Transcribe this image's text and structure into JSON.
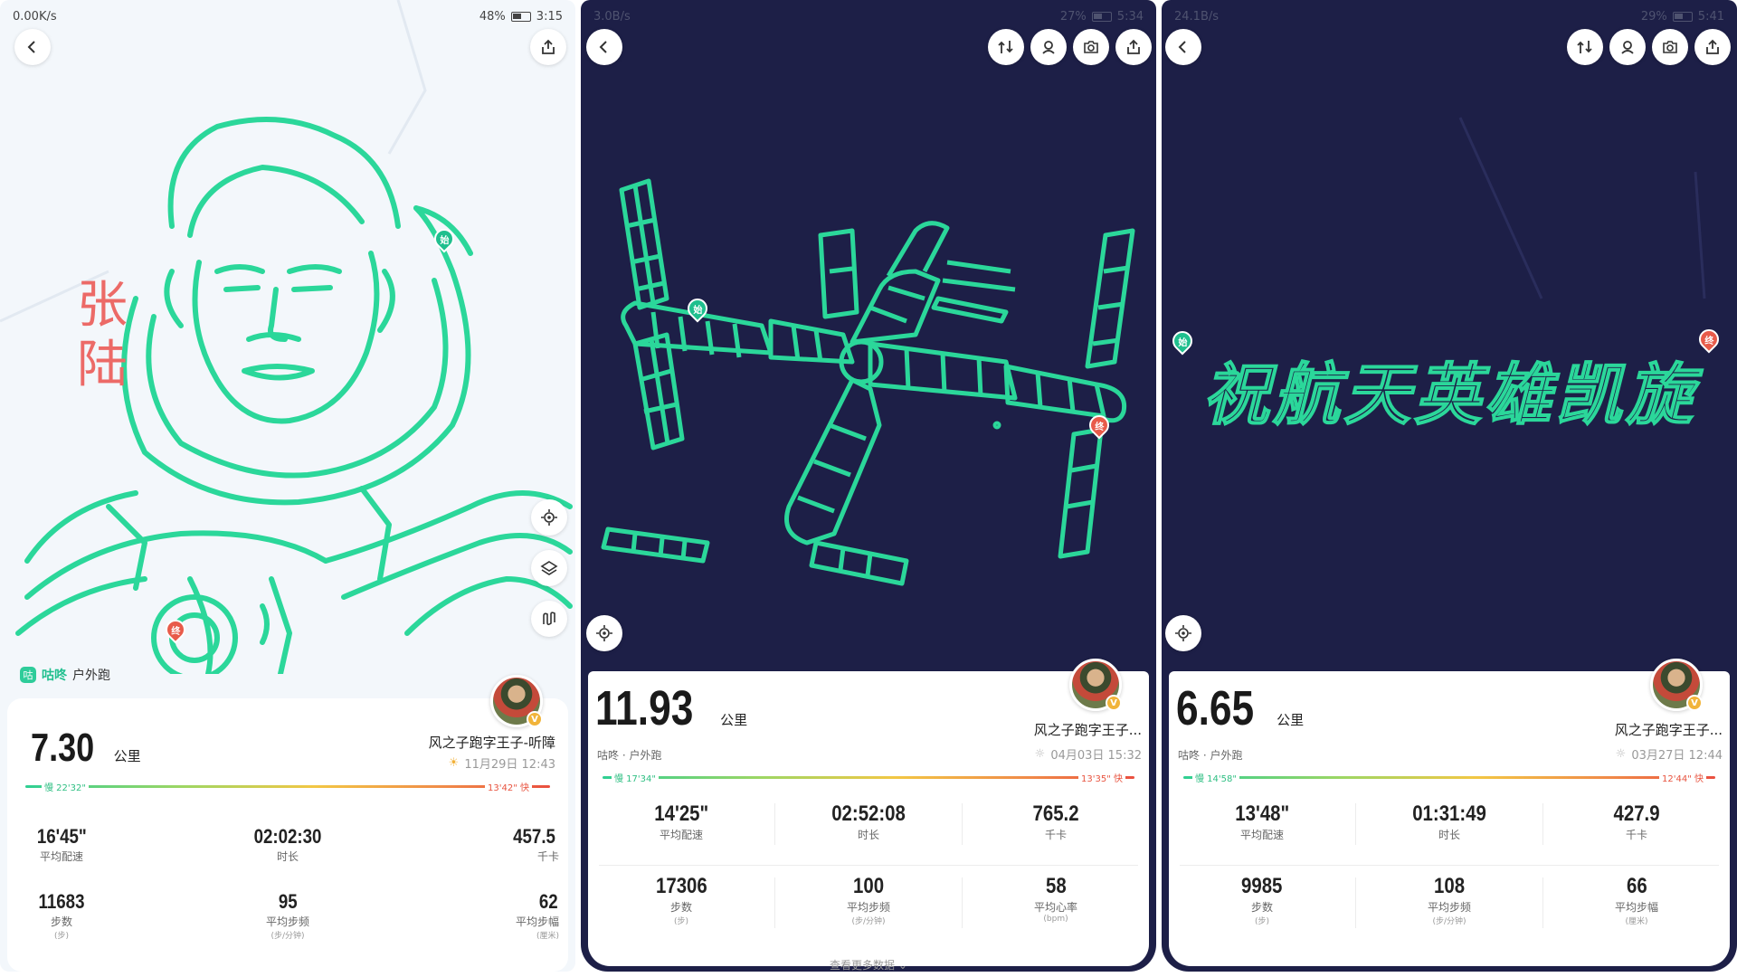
{
  "panels": [
    {
      "status": {
        "net": "0.00K/s",
        "battery": "48%",
        "time": "3:15"
      },
      "name_chars": [
        "张",
        "陆"
      ],
      "brand": {
        "logo": "咕",
        "name": "咕咚",
        "type": "户外跑"
      },
      "summary": {
        "distance": "7.30",
        "unit": "公里",
        "user": "风之子跑字王子-听障",
        "date": "11月29日 12:43"
      },
      "pace": {
        "slow": "慢 22'32\"",
        "fast": "13'42\" 快"
      },
      "stats": [
        {
          "value": "16'45\"",
          "label": "平均配速",
          "sub": ""
        },
        {
          "value": "02:02:30",
          "label": "时长",
          "sub": ""
        },
        {
          "value": "457.5",
          "label": "千卡",
          "sub": ""
        },
        {
          "value": "11683",
          "label": "步数",
          "sub": "(步)"
        },
        {
          "value": "95",
          "label": "平均步频",
          "sub": "(步/分钟)"
        },
        {
          "value": "62",
          "label": "平均步幅",
          "sub": "(厘米)"
        }
      ],
      "pins": {
        "start": "始",
        "end": "终"
      },
      "icons": [
        "back-icon",
        "share-icon",
        "locate-icon",
        "layers-icon",
        "route-icon"
      ]
    },
    {
      "status": {
        "net": "3.0B/s",
        "battery": "27%",
        "time": "5:34"
      },
      "brand": {
        "type": "咕咚 · 户外跑"
      },
      "summary": {
        "distance": "11.93",
        "unit": "公里",
        "user": "风之子跑字王子...",
        "date": "04月03日 15:32"
      },
      "pace": {
        "slow": "慢 17'34\"",
        "fast": "13'35\" 快"
      },
      "stats": [
        {
          "value": "14'25\"",
          "label": "平均配速",
          "sub": ""
        },
        {
          "value": "02:52:08",
          "label": "时长",
          "sub": ""
        },
        {
          "value": "765.2",
          "label": "千卡",
          "sub": ""
        },
        {
          "value": "17306",
          "label": "步数",
          "sub": "(步)"
        },
        {
          "value": "100",
          "label": "平均步频",
          "sub": "(步/分钟)"
        },
        {
          "value": "58",
          "label": "平均心率",
          "sub": "(bpm)"
        }
      ],
      "more": "查看更多数据",
      "pins": {
        "start": "始",
        "end": "终"
      },
      "icons": [
        "back-icon",
        "route-switch-icon",
        "track-icon",
        "camera-icon",
        "share-icon",
        "locate-icon"
      ]
    },
    {
      "status": {
        "net": "24.1B/s",
        "battery": "29%",
        "time": "5:41"
      },
      "brand": {
        "type": "咕咚 · 户外跑"
      },
      "slogan": "祝航天英雄凯旋",
      "summary": {
        "distance": "6.65",
        "unit": "公里",
        "user": "风之子跑字王子...",
        "date": "03月27日 12:44"
      },
      "pace": {
        "slow": "慢 14'58\"",
        "fast": "12'44\" 快"
      },
      "stats": [
        {
          "value": "13'48\"",
          "label": "平均配速",
          "sub": ""
        },
        {
          "value": "01:31:49",
          "label": "时长",
          "sub": ""
        },
        {
          "value": "427.9",
          "label": "千卡",
          "sub": ""
        },
        {
          "value": "9985",
          "label": "步数",
          "sub": "(步)"
        },
        {
          "value": "108",
          "label": "平均步频",
          "sub": "(步/分钟)"
        },
        {
          "value": "66",
          "label": "平均步幅",
          "sub": "(厘米)"
        }
      ],
      "pins": {
        "start": "始",
        "end": "终"
      },
      "icons": [
        "back-icon",
        "route-switch-icon",
        "track-icon",
        "camera-icon",
        "share-icon",
        "locate-icon"
      ]
    }
  ],
  "colors": {
    "route": "#2bd79a",
    "map_dark": "#1d1f47",
    "map_light": "#f3f7fb",
    "accent_red": "#ec6a67"
  }
}
